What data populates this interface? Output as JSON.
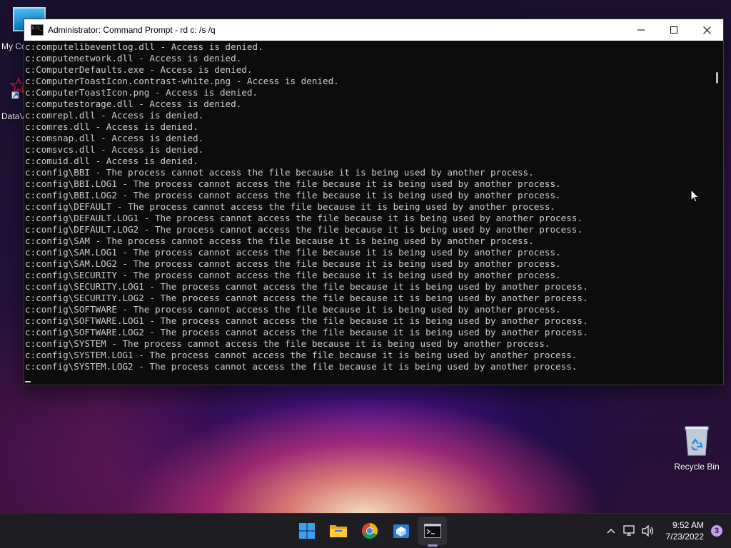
{
  "desktop": {
    "icons": [
      {
        "label": "My Co"
      },
      {
        "label": "DataV"
      },
      {
        "label": "Recycle Bin"
      }
    ]
  },
  "window": {
    "title": "Administrator: Command Prompt - rd  c: /s /q",
    "console_lines": [
      "c:computelibeventlog.dll - Access is denied.",
      "c:computenetwork.dll - Access is denied.",
      "c:ComputerDefaults.exe - Access is denied.",
      "c:ComputerToastIcon.contrast-white.png - Access is denied.",
      "c:ComputerToastIcon.png - Access is denied.",
      "c:computestorage.dll - Access is denied.",
      "c:comrepl.dll - Access is denied.",
      "c:comres.dll - Access is denied.",
      "c:comsnap.dll - Access is denied.",
      "c:comsvcs.dll - Access is denied.",
      "c:comuid.dll - Access is denied.",
      "c:config\\BBI - The process cannot access the file because it is being used by another process.",
      "c:config\\BBI.LOG1 - The process cannot access the file because it is being used by another process.",
      "c:config\\BBI.LOG2 - The process cannot access the file because it is being used by another process.",
      "c:config\\DEFAULT - The process cannot access the file because it is being used by another process.",
      "c:config\\DEFAULT.LOG1 - The process cannot access the file because it is being used by another process.",
      "c:config\\DEFAULT.LOG2 - The process cannot access the file because it is being used by another process.",
      "c:config\\SAM - The process cannot access the file because it is being used by another process.",
      "c:config\\SAM.LOG1 - The process cannot access the file because it is being used by another process.",
      "c:config\\SAM.LOG2 - The process cannot access the file because it is being used by another process.",
      "c:config\\SECURITY - The process cannot access the file because it is being used by another process.",
      "c:config\\SECURITY.LOG1 - The process cannot access the file because it is being used by another process.",
      "c:config\\SECURITY.LOG2 - The process cannot access the file because it is being used by another process.",
      "c:config\\SOFTWARE - The process cannot access the file because it is being used by another process.",
      "c:config\\SOFTWARE.LOG1 - The process cannot access the file because it is being used by another process.",
      "c:config\\SOFTWARE.LOG2 - The process cannot access the file because it is being used by another process.",
      "c:config\\SYSTEM - The process cannot access the file because it is being used by another process.",
      "c:config\\SYSTEM.LOG1 - The process cannot access the file because it is being used by another process.",
      "c:config\\SYSTEM.LOG2 - The process cannot access the file because it is being used by another process."
    ]
  },
  "taskbar": {
    "apps": [
      {
        "name": "start-button-icon"
      },
      {
        "name": "file-explorer-icon"
      },
      {
        "name": "chrome-icon"
      },
      {
        "name": "app-store-box-icon"
      },
      {
        "name": "command-prompt-icon"
      }
    ],
    "clock": {
      "time": "9:52 AM",
      "date": "7/23/2022"
    },
    "notification_count": "3"
  },
  "colors": {
    "console_bg": "#0c0c0c",
    "console_text": "#cccccc",
    "taskbar_bg": "#1e1e22",
    "active_indicator": "#b08cd8"
  }
}
